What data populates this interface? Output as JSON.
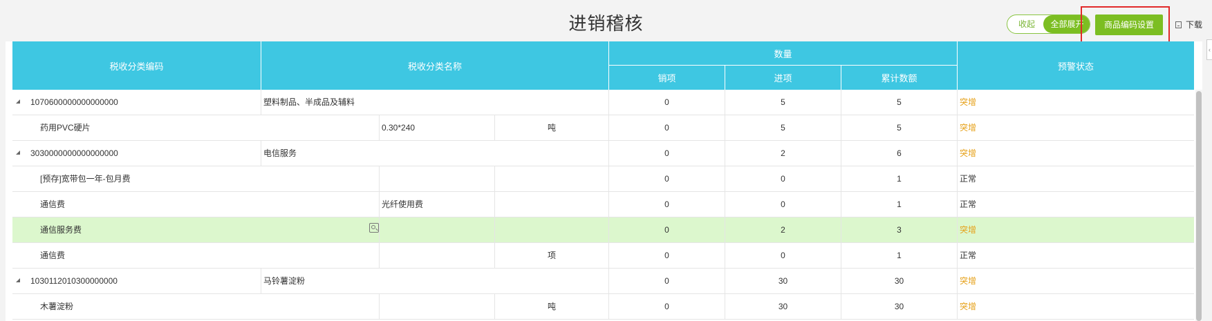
{
  "page": {
    "title": "进销稽核"
  },
  "toolbar": {
    "collapse_label": "收起",
    "expand_label": "全部展开",
    "code_settings_label": "商品编码设置",
    "download_label": "下载"
  },
  "colors": {
    "header_bg": "#3ec7e2",
    "accent_green": "#7cbe22",
    "warning": "#e6a11a",
    "selected_row": "#dcf7cd",
    "highlight_box": "#e12828"
  },
  "table": {
    "headers": {
      "tax_code": "税收分类编码",
      "tax_name": "税收分类名称",
      "quantity": "数量",
      "sales": "销项",
      "purchases": "进项",
      "cumulative": "累计数额",
      "alert_status": "预警状态"
    },
    "rows": [
      {
        "type": "group",
        "code": "1070600000000000000",
        "name": "塑料制品、半成品及辅料",
        "sales": "0",
        "purchases": "5",
        "cumulative": "5",
        "status": "突增",
        "status_kind": "warn"
      },
      {
        "type": "item",
        "goods": "药用PVC硬片",
        "spec": "0.30*240",
        "unit": "吨",
        "sales": "0",
        "purchases": "5",
        "cumulative": "5",
        "status": "突增",
        "status_kind": "warn"
      },
      {
        "type": "group",
        "code": "3030000000000000000",
        "name": "电信服务",
        "sales": "0",
        "purchases": "2",
        "cumulative": "6",
        "status": "突增",
        "status_kind": "warn"
      },
      {
        "type": "item",
        "goods": "[预存]宽带包一年-包月费",
        "spec": "",
        "unit": "",
        "sales": "0",
        "purchases": "0",
        "cumulative": "1",
        "status": "正常",
        "status_kind": "normal"
      },
      {
        "type": "item",
        "goods": "通信费",
        "spec": "光纤使用费",
        "unit": "",
        "sales": "0",
        "purchases": "0",
        "cumulative": "1",
        "status": "正常",
        "status_kind": "normal"
      },
      {
        "type": "item",
        "goods": "通信服务费",
        "spec": "",
        "unit": "",
        "sales": "0",
        "purchases": "2",
        "cumulative": "3",
        "status": "突增",
        "status_kind": "warn",
        "selected": true
      },
      {
        "type": "item",
        "goods": "通信费",
        "spec": "",
        "unit": "项",
        "sales": "0",
        "purchases": "0",
        "cumulative": "1",
        "status": "正常",
        "status_kind": "normal"
      },
      {
        "type": "group",
        "code": "1030112010300000000",
        "name": "马铃薯淀粉",
        "sales": "0",
        "purchases": "30",
        "cumulative": "30",
        "status": "突增",
        "status_kind": "warn"
      },
      {
        "type": "item",
        "goods": "木薯淀粉",
        "spec": "",
        "unit": "吨",
        "sales": "0",
        "purchases": "30",
        "cumulative": "30",
        "status": "突增",
        "status_kind": "warn"
      }
    ]
  }
}
